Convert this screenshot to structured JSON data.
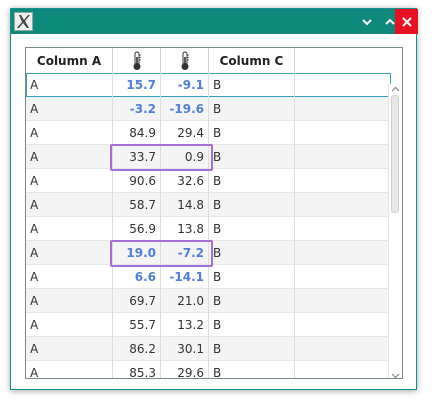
{
  "window": {
    "icon": "x-logo-icon",
    "buttons": {
      "minimize": "chevron-down-icon",
      "maximize": "chevron-up-icon",
      "close": "close-icon"
    }
  },
  "table": {
    "columns": [
      {
        "label": "Column A",
        "type": "text"
      },
      {
        "label": "",
        "icon": "thermometer-icon",
        "type": "number"
      },
      {
        "label": "",
        "icon": "thermometer-icon",
        "type": "number"
      },
      {
        "label": "Column C",
        "type": "text"
      }
    ],
    "rows": [
      {
        "a": "A",
        "t1": "15.7",
        "t2": "-9.1",
        "c": "B",
        "cold": true
      },
      {
        "a": "A",
        "t1": "-3.2",
        "t2": "-19.6",
        "c": "B",
        "cold": true
      },
      {
        "a": "A",
        "t1": "84.9",
        "t2": "29.4",
        "c": "B",
        "cold": false
      },
      {
        "a": "A",
        "t1": "33.7",
        "t2": "0.9",
        "c": "B",
        "cold": false
      },
      {
        "a": "A",
        "t1": "90.6",
        "t2": "32.6",
        "c": "B",
        "cold": false
      },
      {
        "a": "A",
        "t1": "58.7",
        "t2": "14.8",
        "c": "B",
        "cold": false
      },
      {
        "a": "A",
        "t1": "56.9",
        "t2": "13.8",
        "c": "B",
        "cold": false
      },
      {
        "a": "A",
        "t1": "19.0",
        "t2": "-7.2",
        "c": "B",
        "cold": true
      },
      {
        "a": "A",
        "t1": "6.6",
        "t2": "-14.1",
        "c": "B",
        "cold": true
      },
      {
        "a": "A",
        "t1": "69.7",
        "t2": "21.0",
        "c": "B",
        "cold": false
      },
      {
        "a": "A",
        "t1": "55.7",
        "t2": "13.2",
        "c": "B",
        "cold": false
      },
      {
        "a": "A",
        "t1": "86.2",
        "t2": "30.1",
        "c": "B",
        "cold": false
      },
      {
        "a": "A",
        "t1": "85.3",
        "t2": "29.6",
        "c": "B",
        "cold": false
      }
    ],
    "selected_row": 0,
    "highlighted_rows": [
      3,
      7
    ]
  },
  "colors": {
    "titlebar": "#0e8a7c",
    "close": "#e81123",
    "cold_text": "#4f7fd6",
    "highlight": "#a46fd6",
    "selection": "#39a1b3"
  }
}
